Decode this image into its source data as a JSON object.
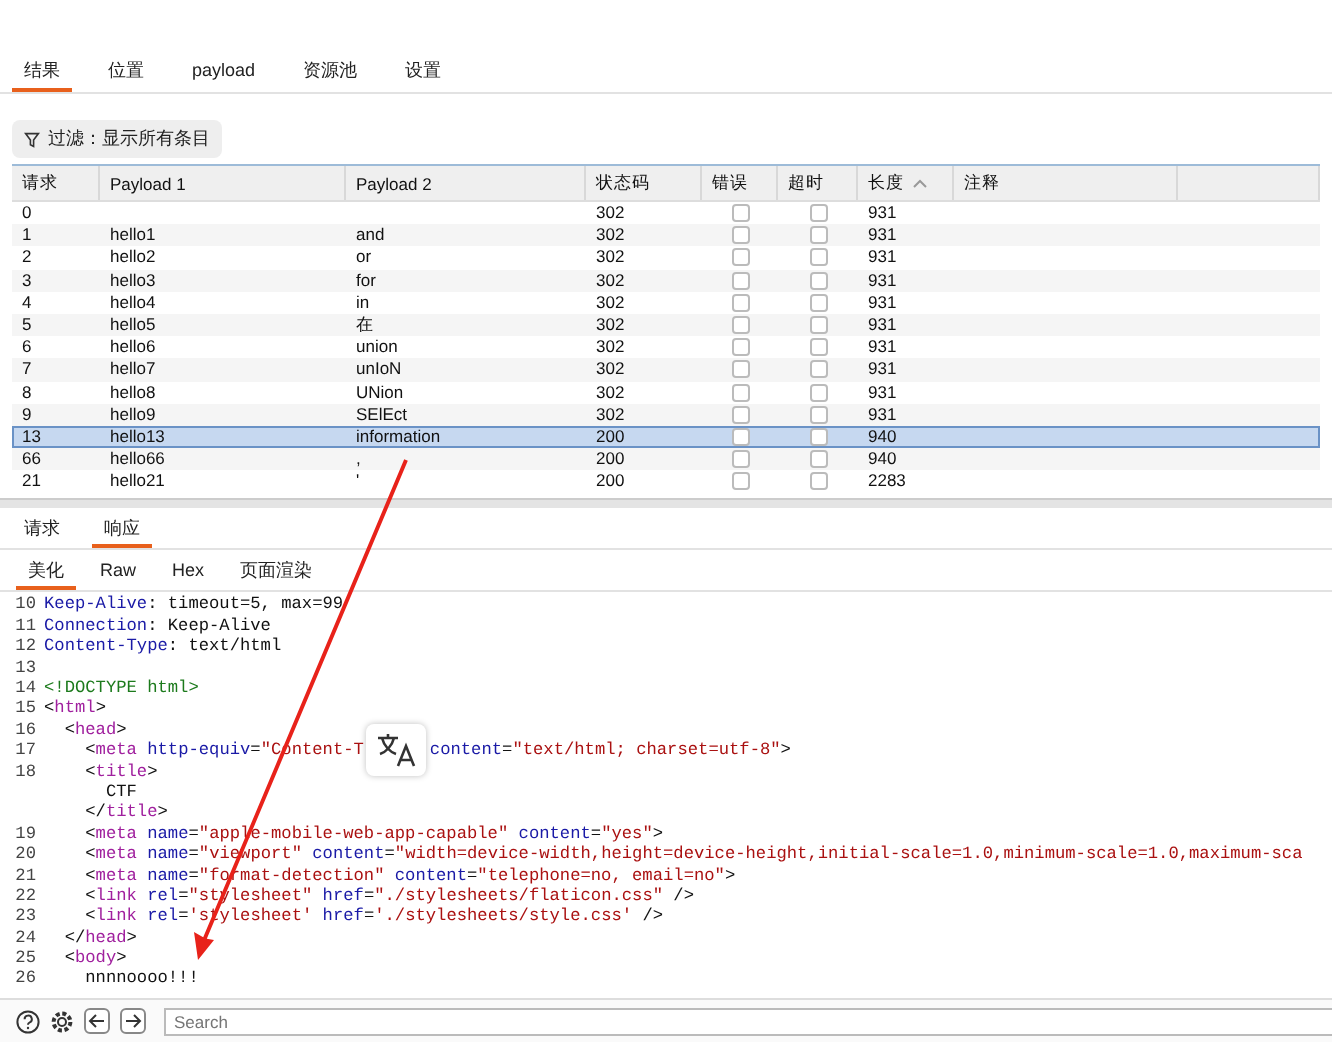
{
  "main_tabs": [
    {
      "label": "结果",
      "selected": true
    },
    {
      "label": "位置",
      "selected": false
    },
    {
      "label": "payload",
      "selected": false
    },
    {
      "label": "资源池",
      "selected": false
    },
    {
      "label": "设置",
      "selected": false
    }
  ],
  "filter": {
    "label": "过滤：显示所有条目"
  },
  "table": {
    "columns": [
      {
        "label": "请求",
        "kind": "text"
      },
      {
        "label": "Payload 1",
        "kind": "text"
      },
      {
        "label": "Payload 2",
        "kind": "text"
      },
      {
        "label": "状态码",
        "kind": "text"
      },
      {
        "label": "错误",
        "kind": "check"
      },
      {
        "label": "超时",
        "kind": "check"
      },
      {
        "label": "长度",
        "kind": "sorted"
      },
      {
        "label": "注释",
        "kind": "text"
      }
    ],
    "rows": [
      {
        "request": "0",
        "status": "302",
        "error": false,
        "timeout": false,
        "length": "931",
        "selected": false
      },
      {
        "request": "1",
        "payload_1": "hello1",
        "payload_2": "and",
        "status": "302",
        "error": false,
        "timeout": false,
        "length": "931",
        "selected": false
      },
      {
        "request": "2",
        "payload_1": "hello2",
        "payload_2": "or",
        "status": "302",
        "error": false,
        "timeout": false,
        "length": "931",
        "selected": false
      },
      {
        "request": "3",
        "payload_1": "hello3",
        "payload_2": "for",
        "status": "302",
        "error": false,
        "timeout": false,
        "length": "931",
        "selected": false
      },
      {
        "request": "4",
        "payload_1": "hello4",
        "payload_2": "in",
        "status": "302",
        "error": false,
        "timeout": false,
        "length": "931",
        "selected": false
      },
      {
        "request": "5",
        "payload_1": "hello5",
        "payload_2": "在",
        "status": "302",
        "error": false,
        "timeout": false,
        "length": "931",
        "selected": false
      },
      {
        "request": "6",
        "payload_1": "hello6",
        "payload_2": "union",
        "status": "302",
        "error": false,
        "timeout": false,
        "length": "931",
        "selected": false
      },
      {
        "request": "7",
        "payload_1": "hello7",
        "payload_2": "unIoN",
        "status": "302",
        "error": false,
        "timeout": false,
        "length": "931",
        "selected": false
      },
      {
        "request": "8",
        "payload_1": "hello8",
        "payload_2": "UNion",
        "status": "302",
        "error": false,
        "timeout": false,
        "length": "931",
        "selected": false
      },
      {
        "request": "9",
        "payload_1": "hello9",
        "payload_2": "SElEct",
        "status": "302",
        "error": false,
        "timeout": false,
        "length": "931",
        "selected": false
      },
      {
        "request": "13",
        "payload_1": "hello13",
        "payload_2": "information",
        "status": "200",
        "error": false,
        "timeout": false,
        "length": "940",
        "selected": true
      },
      {
        "request": "66",
        "payload_1": "hello66",
        "payload_2": ",",
        "status": "200",
        "error": false,
        "timeout": false,
        "length": "940",
        "selected": false
      },
      {
        "request": "21",
        "payload_1": "hello21",
        "payload_2": "'",
        "status": "200",
        "error": false,
        "timeout": false,
        "length": "2283",
        "selected": false
      }
    ]
  },
  "message_tabs": [
    {
      "label": "请求",
      "selected": false
    },
    {
      "label": "响应",
      "selected": true
    }
  ],
  "view_tabs": [
    {
      "label": "美化",
      "selected": true
    },
    {
      "label": "Raw",
      "selected": false
    },
    {
      "label": "Hex",
      "selected": false
    },
    {
      "label": "页面渲染",
      "selected": false
    }
  ],
  "code_lines": [
    {
      "number": "10",
      "tokens": [
        {
          "kind": "key",
          "text": "Keep-Alive"
        },
        {
          "kind": "text",
          "text": ": timeout=5, max=99"
        }
      ]
    },
    {
      "number": "11",
      "tokens": [
        {
          "kind": "key",
          "text": "Connection"
        },
        {
          "kind": "text",
          "text": ": Keep-Alive"
        }
      ]
    },
    {
      "number": "12",
      "tokens": [
        {
          "kind": "key",
          "text": "Content-Type"
        },
        {
          "kind": "text",
          "text": ": text/html"
        }
      ]
    },
    {
      "number": "13"
    },
    {
      "number": "14",
      "tokens": [
        {
          "kind": "doctype",
          "text": "<!DOCTYPE html>"
        }
      ]
    },
    {
      "number": "15",
      "tokens": [
        {
          "kind": "text",
          "text": "<"
        },
        {
          "kind": "tag",
          "text": "html"
        },
        {
          "kind": "text",
          "text": ">"
        }
      ]
    },
    {
      "number": "16",
      "tokens": [
        {
          "kind": "text",
          "text": "  <"
        },
        {
          "kind": "tag",
          "text": "head"
        },
        {
          "kind": "text",
          "text": ">"
        }
      ]
    },
    {
      "number": "17",
      "tokens": [
        {
          "kind": "text",
          "text": "    <"
        },
        {
          "kind": "tag",
          "text": "meta"
        },
        {
          "kind": "attr",
          "text": " http-equiv"
        },
        {
          "kind": "text",
          "text": "="
        },
        {
          "kind": "str",
          "text": "\"Content-T"
        },
        {
          "kind": "covered"
        },
        {
          "kind": "attr",
          "text": "content"
        },
        {
          "kind": "text",
          "text": "="
        },
        {
          "kind": "str",
          "text": "\"text/html; charset=utf-8\""
        },
        {
          "kind": "text",
          "text": ">"
        }
      ]
    },
    {
      "number": "18",
      "tokens": [
        {
          "kind": "text",
          "text": "    <"
        },
        {
          "kind": "tag",
          "text": "title"
        },
        {
          "kind": "text",
          "text": ">"
        }
      ]
    },
    {
      "tokens": [
        {
          "kind": "text",
          "text": "      CTF"
        }
      ]
    },
    {
      "tokens": [
        {
          "kind": "text",
          "text": "    </"
        },
        {
          "kind": "tag",
          "text": "title"
        },
        {
          "kind": "text",
          "text": ">"
        }
      ]
    },
    {
      "number": "19",
      "tokens": [
        {
          "kind": "text",
          "text": "    <"
        },
        {
          "kind": "tag",
          "text": "meta"
        },
        {
          "kind": "attr",
          "text": " name"
        },
        {
          "kind": "text",
          "text": "="
        },
        {
          "kind": "str",
          "text": "\"apple-mobile-web-app-capable\""
        },
        {
          "kind": "attr",
          "text": " content"
        },
        {
          "kind": "text",
          "text": "="
        },
        {
          "kind": "str",
          "text": "\"yes\""
        },
        {
          "kind": "text",
          "text": ">"
        }
      ]
    },
    {
      "number": "20",
      "tokens": [
        {
          "kind": "text",
          "text": "    <"
        },
        {
          "kind": "tag",
          "text": "meta"
        },
        {
          "kind": "attr",
          "text": " name"
        },
        {
          "kind": "text",
          "text": "="
        },
        {
          "kind": "str",
          "text": "\"viewport\""
        },
        {
          "kind": "attr",
          "text": " content"
        },
        {
          "kind": "text",
          "text": "="
        },
        {
          "kind": "str",
          "text": "\"width=device-width,height=device-height,initial-scale=1.0,minimum-scale=1.0,maximum-sca"
        }
      ]
    },
    {
      "number": "21",
      "tokens": [
        {
          "kind": "text",
          "text": "    <"
        },
        {
          "kind": "tag",
          "text": "meta"
        },
        {
          "kind": "attr",
          "text": " name"
        },
        {
          "kind": "text",
          "text": "="
        },
        {
          "kind": "str",
          "text": "\"format-detection\""
        },
        {
          "kind": "attr",
          "text": " content"
        },
        {
          "kind": "text",
          "text": "="
        },
        {
          "kind": "str",
          "text": "\"telephone=no, email=no\""
        },
        {
          "kind": "text",
          "text": ">"
        }
      ]
    },
    {
      "number": "22",
      "tokens": [
        {
          "kind": "text",
          "text": "    <"
        },
        {
          "kind": "tag",
          "text": "link"
        },
        {
          "kind": "attr",
          "text": " rel"
        },
        {
          "kind": "text",
          "text": "="
        },
        {
          "kind": "str",
          "text": "\"stylesheet\""
        },
        {
          "kind": "attr",
          "text": " href"
        },
        {
          "kind": "text",
          "text": "="
        },
        {
          "kind": "str",
          "text": "\"./stylesheets/flaticon.css\""
        },
        {
          "kind": "text",
          "text": " />"
        }
      ]
    },
    {
      "number": "23",
      "tokens": [
        {
          "kind": "text",
          "text": "    <"
        },
        {
          "kind": "tag",
          "text": "link"
        },
        {
          "kind": "attr",
          "text": " rel"
        },
        {
          "kind": "text",
          "text": "="
        },
        {
          "kind": "str",
          "text": "'stylesheet'"
        },
        {
          "kind": "attr",
          "text": " href"
        },
        {
          "kind": "text",
          "text": "="
        },
        {
          "kind": "str",
          "text": "'./stylesheets/style.css'"
        },
        {
          "kind": "text",
          "text": " />"
        }
      ]
    },
    {
      "number": "24",
      "tokens": [
        {
          "kind": "text",
          "text": "  </"
        },
        {
          "kind": "tag",
          "text": "head"
        },
        {
          "kind": "text",
          "text": ">"
        }
      ]
    },
    {
      "number": "25",
      "tokens": [
        {
          "kind": "text",
          "text": "  <"
        },
        {
          "kind": "tag",
          "text": "body"
        },
        {
          "kind": "text",
          "text": ">"
        }
      ]
    },
    {
      "number": "26",
      "tokens": [
        {
          "kind": "text",
          "text": "    nnnnoooo!!!"
        }
      ]
    }
  ],
  "search": {
    "placeholder": "Search"
  }
}
